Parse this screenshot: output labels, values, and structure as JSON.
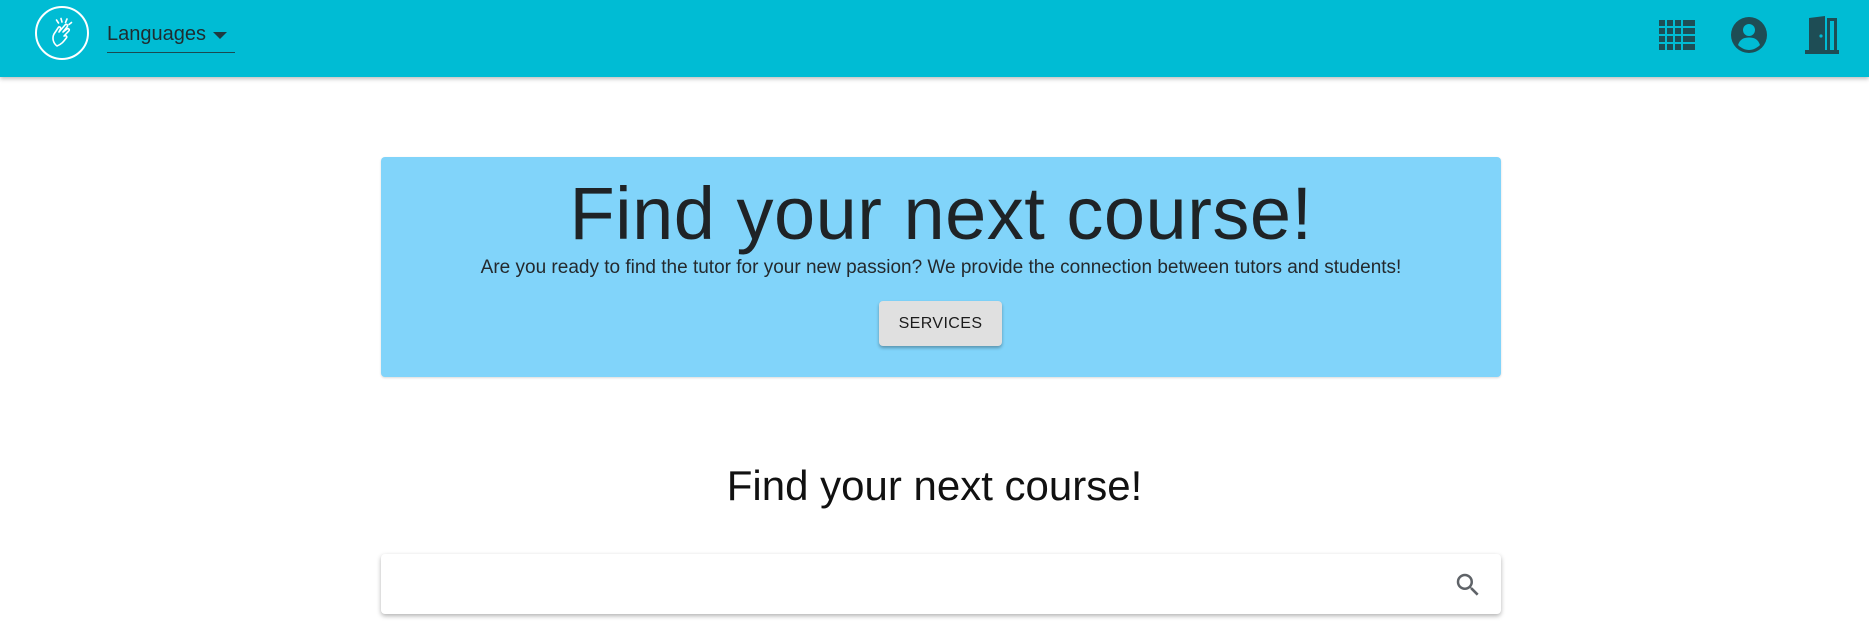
{
  "colors": {
    "topbar": "#00bcd4",
    "hero_background": "#81d4fa",
    "button_background": "#e0e0e0",
    "icon_dark": "#1e4d55"
  },
  "header": {
    "logo_icon": "hand-snap-icon",
    "language_selector": {
      "label": "Languages",
      "icon": "caret-down-icon"
    },
    "actions": [
      {
        "name": "apps",
        "icon": "apps-grid-icon"
      },
      {
        "name": "account",
        "icon": "account-circle-icon"
      },
      {
        "name": "logout",
        "icon": "door-exit-icon"
      }
    ]
  },
  "hero": {
    "title": "Find your next course!",
    "subtitle": "Are you ready to find the tutor for your new passion? We provide the connection between tutors and students!",
    "button_label": "SERVICES"
  },
  "search_section": {
    "title": "Find your next course!",
    "input_value": "",
    "placeholder": "",
    "icon": "search-icon"
  }
}
